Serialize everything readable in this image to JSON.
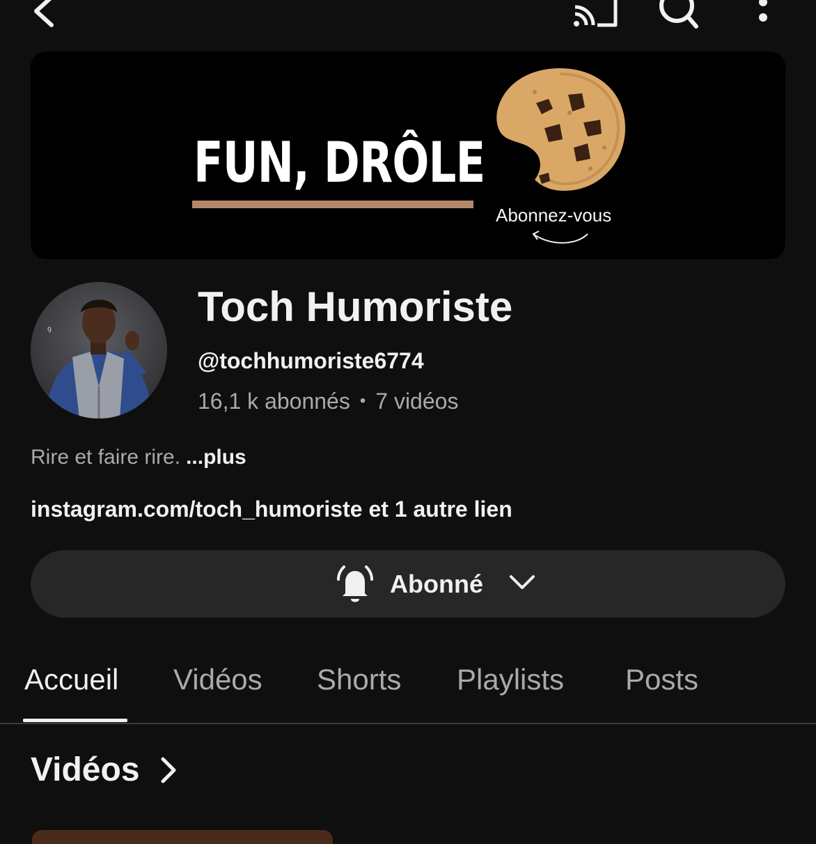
{
  "topbar": {
    "back_icon": "back-arrow-icon",
    "cast_icon": "cast-icon",
    "search_icon": "search-icon",
    "more_icon": "more-vertical-icon"
  },
  "banner": {
    "title": "FUN, DRÔLE",
    "cta": "Abonnez-vous",
    "accent_color": "#b3886a"
  },
  "channel": {
    "name": "Toch Humoriste",
    "handle": "@tochhumoriste6774",
    "subscribers": "16,1 k abonnés",
    "separator": "•",
    "videos": "7 vidéos",
    "description": "Rire et faire rire.",
    "more_label": "...plus",
    "links": "instagram.com/toch_humoriste et 1 autre lien"
  },
  "subscribe": {
    "label": "Abonné",
    "bell_icon": "bell-ringing-icon",
    "chevron_icon": "chevron-down-icon"
  },
  "tabs": [
    {
      "label": "Accueil",
      "active": true
    },
    {
      "label": "Vidéos",
      "active": false
    },
    {
      "label": "Shorts",
      "active": false
    },
    {
      "label": "Playlists",
      "active": false
    },
    {
      "label": "Posts",
      "active": false
    }
  ],
  "section": {
    "title": "Vidéos"
  },
  "colors": {
    "background": "#0f0f0f",
    "secondary_text": "#aaaaaa",
    "button_bg": "#272727"
  }
}
